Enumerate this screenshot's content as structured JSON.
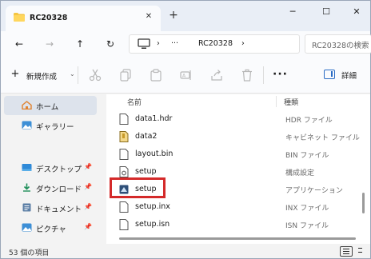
{
  "tab": {
    "title": "RC20328",
    "close": "✕",
    "new_tab": "+"
  },
  "window_controls": {
    "minimize": "─",
    "maximize": "☐",
    "close": "✕"
  },
  "nav": {
    "back": "←",
    "forward": "→",
    "up": "↑",
    "refresh": "↻"
  },
  "address": {
    "sep1": "›",
    "ellipsis": "···",
    "folder": "RC20328",
    "sep2": "›"
  },
  "search": {
    "placeholder": "RC20328の検索"
  },
  "commandbar": {
    "new_label": "新規作成",
    "new_plus": "+",
    "new_chevron": "⌄",
    "more": "···",
    "details_label": "詳細",
    "icons": [
      "cut-icon",
      "copy-icon",
      "paste-icon",
      "rename-icon",
      "share-icon",
      "delete-icon"
    ]
  },
  "sidebar": {
    "items": [
      {
        "label": "ホーム",
        "icon": "home-icon",
        "selected": true,
        "pinned": false
      },
      {
        "label": "ギャラリー",
        "icon": "gallery-icon",
        "selected": false,
        "pinned": false
      },
      {
        "label": "デスクトップ",
        "icon": "desktop-icon",
        "selected": false,
        "pinned": true
      },
      {
        "label": "ダウンロード",
        "icon": "download-icon",
        "selected": false,
        "pinned": true
      },
      {
        "label": "ドキュメント",
        "icon": "document-icon",
        "selected": false,
        "pinned": true
      },
      {
        "label": "ピクチャ",
        "icon": "picture-icon",
        "selected": false,
        "pinned": true
      }
    ],
    "pin_glyph": "📌"
  },
  "filelist": {
    "columns": {
      "name": "名前",
      "type": "種類"
    },
    "rows": [
      {
        "name": "data1.hdr",
        "type": "HDR ファイル",
        "icon": "file-icon"
      },
      {
        "name": "data2",
        "type": "キャビネット ファイル",
        "icon": "cabinet-icon"
      },
      {
        "name": "layout.bin",
        "type": "BIN ファイル",
        "icon": "file-icon"
      },
      {
        "name": "setup",
        "type": "構成設定",
        "icon": "settings-file-icon"
      },
      {
        "name": "setup",
        "type": "アプリケーション",
        "icon": "setup-app-icon"
      },
      {
        "name": "setup.inx",
        "type": "INX ファイル",
        "icon": "file-icon"
      },
      {
        "name": "setup.isn",
        "type": "ISN ファイル",
        "icon": "file-icon"
      }
    ],
    "highlighted_row": 4
  },
  "status": {
    "count": "53 個の項目"
  },
  "colors": {
    "accent": "#2b6cc4",
    "highlight_border": "#d42a2a",
    "folder": "#f5c542"
  }
}
